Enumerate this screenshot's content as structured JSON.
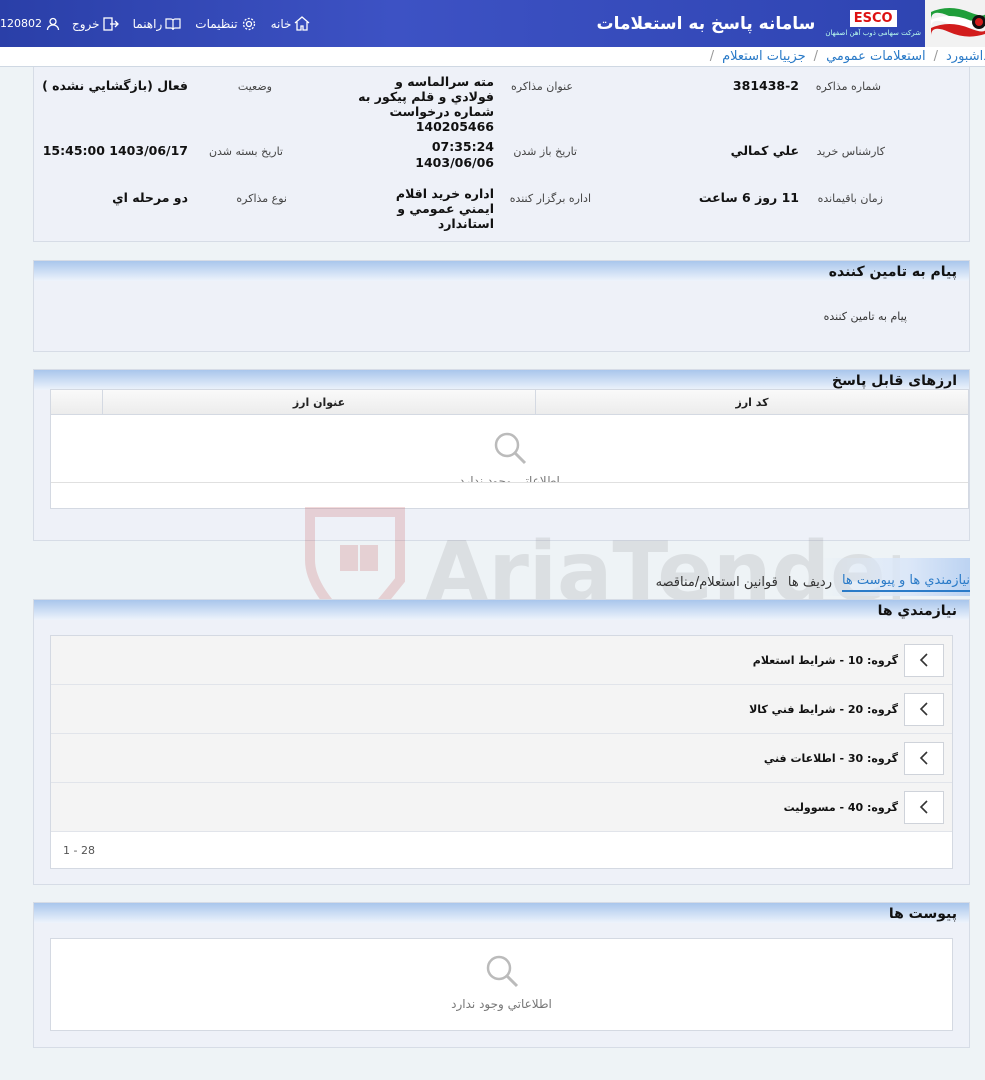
{
  "header": {
    "title": "سامانه پاسخ به استعلامات",
    "brand": "ESCO",
    "brand_sub": "شرکت سهامی ذوب آهن اصفهان",
    "user_id": "120802",
    "links": {
      "home": "خانه",
      "settings": "تنظیمات",
      "help": "راهنما",
      "logout": "خروج"
    }
  },
  "breadcrumb": [
    "داشبورد",
    "استعلامات عمومي",
    "جزييات استعلام"
  ],
  "details": {
    "number_label": "شماره مذاکره",
    "number": "381438-2",
    "subject_label": "عنوان مذاکره",
    "subject": "مته سرالماسه و فولادي و قلم پيکور به شماره درخواست 140205466",
    "status_label": "وضعيت",
    "status": "فعال (بازگشايي نشده )",
    "buyer_label": "کارشناس خريد",
    "buyer": "علي کمالي",
    "open_label": "تاريخ باز شدن",
    "open_time": "07:35:24",
    "open_date": "1403/06/06",
    "close_label": "تاريخ بسته شدن",
    "close": "1403/06/17 15:45:00",
    "remaining_label": "زمان باقيمانده",
    "remaining": "11 روز 6 ساعت",
    "dept_label": "اداره برگزار کننده",
    "dept": "اداره خريد اقلام ايمني عمومي و استاندارد",
    "type_label": "نوع مذاکره",
    "type": "دو مرحله اي"
  },
  "supplier_message": {
    "title": "پيام به تامين کننده",
    "text": "پيام به تامين کننده"
  },
  "currencies": {
    "title": "ارزهای قابل پاسخ",
    "col_code": "کد ارز",
    "col_title": "عنوان ارز",
    "empty": "اطلاعاتي وجود ندارد"
  },
  "tabs": [
    "نيازمندي ها و پيوست ها",
    "رديف ها",
    "قوانين استعلام/مناقصه"
  ],
  "requirements": {
    "title": "نيازمندي ها",
    "groups": [
      "گروه: 10 - شرايط استعلام",
      "گروه: 20 - شرايط فني کالا",
      "گروه: 30 - اطلاعات فني",
      "گروه: 40 - مسووليت"
    ],
    "pager": "1 - 28"
  },
  "attachments": {
    "title": "پيوست ها",
    "empty": "اطلاعاتي وجود ندارد"
  },
  "watermark": "AriaTender.neT",
  "colors": {
    "header": "#2d43b0",
    "link": "#2b7bc8",
    "panel_head": "#a9c6ec",
    "watermark": "#c0393b"
  }
}
